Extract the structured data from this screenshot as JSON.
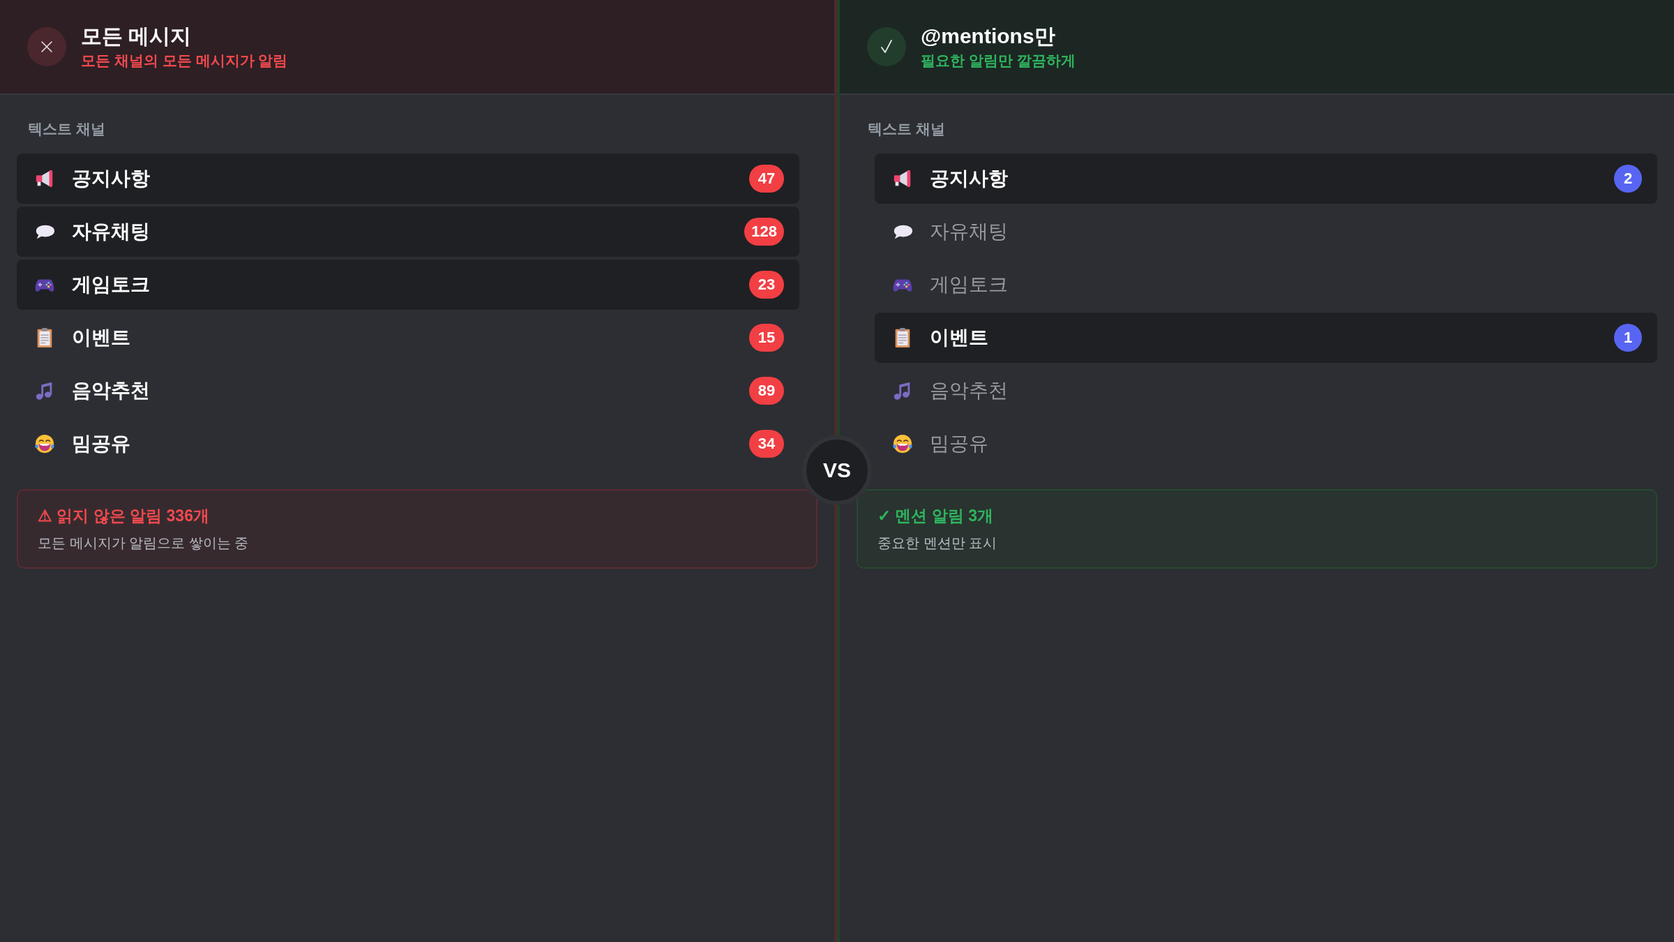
{
  "panels": [
    {
      "kind": "all",
      "title": "모든 메시지",
      "subtitle": "모든 채널의 모든 메시지가 알림",
      "section_label": "텍스트 채널",
      "channels": [
        {
          "name": "공지사항",
          "highlighted": true,
          "muted": false,
          "badge": "47"
        },
        {
          "name": "자유채팅",
          "highlighted": true,
          "muted": false,
          "badge": "128"
        },
        {
          "name": "게임토크",
          "highlighted": true,
          "muted": false,
          "badge": "23"
        },
        {
          "name": "이벤트",
          "highlighted": false,
          "muted": false,
          "badge": "15"
        },
        {
          "name": "음악추천",
          "highlighted": false,
          "muted": false,
          "badge": "89"
        },
        {
          "name": "밈공유",
          "highlighted": false,
          "muted": false,
          "badge": "34"
        }
      ],
      "summary": {
        "title": "⚠ 읽지 않은 알림 336개",
        "detail": "모든 메시지가 알림으로 쌓이는 중"
      }
    },
    {
      "kind": "mentions",
      "title": "@mentions만",
      "subtitle": "필요한 알림만 깔끔하게",
      "section_label": "텍스트 채널",
      "channels": [
        {
          "name": "공지사항",
          "highlighted": true,
          "muted": false,
          "badge": "2"
        },
        {
          "name": "자유채팅",
          "highlighted": false,
          "muted": true
        },
        {
          "name": "게임토크",
          "highlighted": false,
          "muted": true
        },
        {
          "name": "이벤트",
          "highlighted": true,
          "muted": false,
          "badge": "1"
        },
        {
          "name": "음악추천",
          "highlighted": false,
          "muted": true
        },
        {
          "name": "밈공유",
          "highlighted": false,
          "muted": true
        }
      ],
      "summary": {
        "title": "✓ 멘션 알림 3개",
        "detail": "중요한 멘션만 표시"
      }
    }
  ],
  "vs_label": "VS"
}
